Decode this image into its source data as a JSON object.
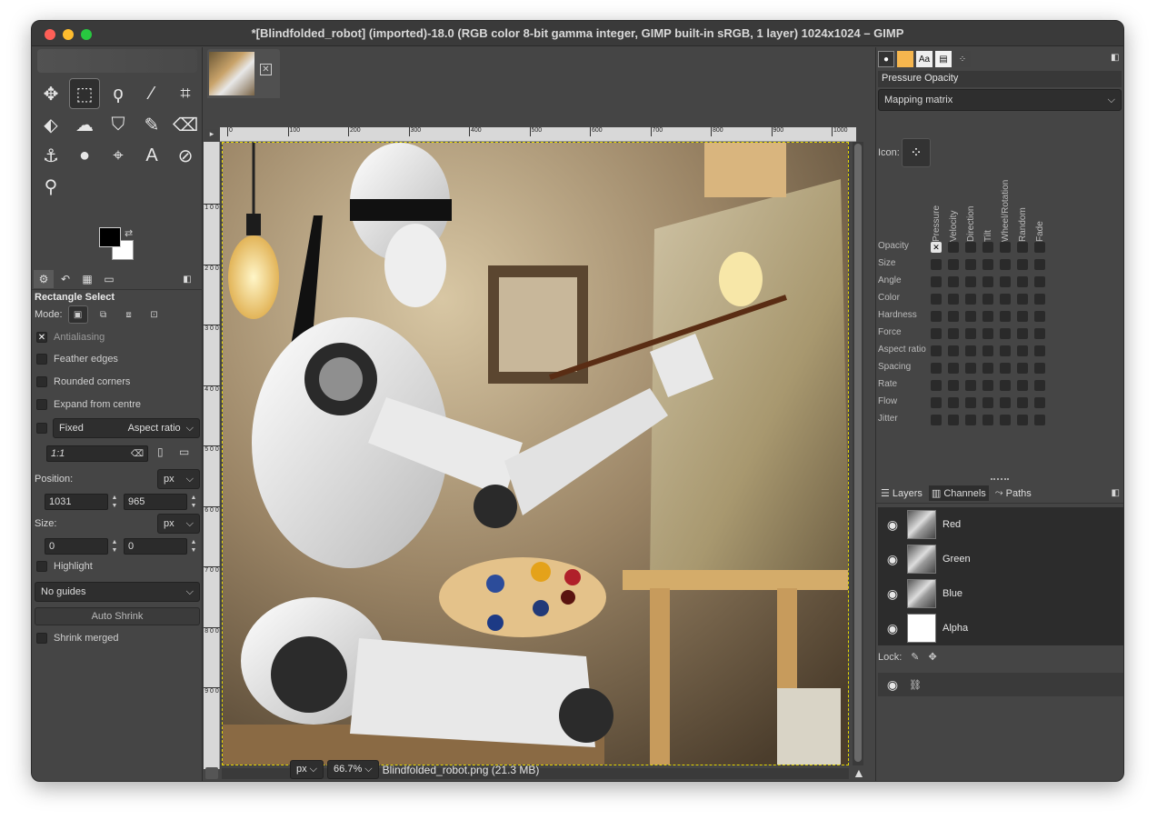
{
  "window": {
    "title": "*[Blindfolded_robot] (imported)-18.0 (RGB color 8-bit gamma integer, GIMP built-in sRGB, 1 layer) 1024x1024 – GIMP"
  },
  "tools": [
    {
      "name": "move-tool",
      "glyph": "✥"
    },
    {
      "name": "rect-select-tool",
      "glyph": "⬚",
      "active": true
    },
    {
      "name": "lasso-tool",
      "glyph": "ϙ"
    },
    {
      "name": "fuzzy-select-tool",
      "glyph": "⁄"
    },
    {
      "name": "crop-tool",
      "glyph": "⌗"
    },
    {
      "name": "transform-tool",
      "glyph": "⬖"
    },
    {
      "name": "warp-tool",
      "glyph": "☁"
    },
    {
      "name": "bucket-fill-tool",
      "glyph": "⛉"
    },
    {
      "name": "paintbrush-tool",
      "glyph": "✎"
    },
    {
      "name": "eraser-tool",
      "glyph": "⌫"
    },
    {
      "name": "clone-tool",
      "glyph": "⚓"
    },
    {
      "name": "dodge-burn-tool",
      "glyph": "●"
    },
    {
      "name": "paths-tool",
      "glyph": "⌖"
    },
    {
      "name": "text-tool",
      "glyph": "A"
    },
    {
      "name": "color-picker-tool",
      "glyph": "⊘"
    },
    {
      "name": "zoom-tool",
      "glyph": "⚲"
    }
  ],
  "tool_options": {
    "title": "Rectangle Select",
    "mode_label": "Mode:",
    "antialiasing": "Antialiasing",
    "feather_edges": "Feather edges",
    "rounded_corners": "Rounded corners",
    "expand_from_centre": "Expand from centre",
    "fixed": "Fixed",
    "aspect_ratio": "Aspect ratio",
    "ratio_value": "1:1",
    "position_label": "Position:",
    "position_unit": "px",
    "position_x": "1031",
    "position_y": "965",
    "size_label": "Size:",
    "size_unit": "px",
    "size_w": "0",
    "size_h": "0",
    "highlight": "Highlight",
    "guides": "No guides",
    "auto_shrink": "Auto Shrink",
    "shrink_merged": "Shrink merged"
  },
  "ruler": {
    "h_ticks": [
      "0",
      "100",
      "200",
      "300",
      "400",
      "500",
      "600",
      "700",
      "800",
      "900",
      "1000"
    ],
    "v_ticks": [
      "1 0 0",
      "2 0 0",
      "3 0 0",
      "4 0 0",
      "5 0 0",
      "6 0 0",
      "7 0 0",
      "8 0 0",
      "9 0 0"
    ]
  },
  "status": {
    "unit": "px",
    "zoom": "66.7%",
    "file": "Blindfolded_robot.png (21.3 MB)"
  },
  "dynamics": {
    "name": "Pressure Opacity",
    "mapping": "Mapping matrix",
    "icon_label": "Icon:",
    "columns": [
      "Pressure",
      "Velocity",
      "Direction",
      "Tilt",
      "Wheel/Rotation",
      "Random",
      "Fade"
    ],
    "rows": [
      "Opacity",
      "Size",
      "Angle",
      "Color",
      "Hardness",
      "Force",
      "Aspect ratio",
      "Spacing",
      "Rate",
      "Flow",
      "Jitter"
    ],
    "checked": {
      "row": 0,
      "col": 0
    }
  },
  "layers_panel": {
    "tabs": [
      "Layers",
      "Channels",
      "Paths"
    ],
    "channels": [
      "Red",
      "Green",
      "Blue",
      "Alpha"
    ],
    "lock_label": "Lock:"
  }
}
